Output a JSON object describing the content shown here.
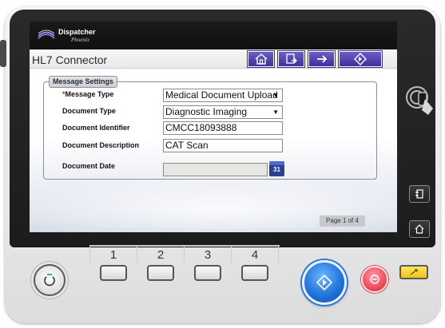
{
  "app": {
    "brand_name": "Dispatcher",
    "brand_sub": "Phoenix"
  },
  "header": {
    "title": "HL7 Connector",
    "buttons": [
      {
        "name": "home",
        "icon": "home-icon"
      },
      {
        "name": "document-transfer",
        "icon": "document-transfer-icon"
      },
      {
        "name": "next",
        "icon": "arrow-right-icon"
      },
      {
        "name": "start",
        "icon": "diamond-start-icon"
      }
    ]
  },
  "form": {
    "legend": "Message Settings",
    "fields": {
      "message_type": {
        "label": "Message Type",
        "required_mark": "*",
        "value": "Medical Document Upload"
      },
      "document_type": {
        "label": "Document Type",
        "value": "Diagnostic Imaging"
      },
      "document_identifier": {
        "label": "Document Identifier",
        "value": "CMCC18093888"
      },
      "document_description": {
        "label": "Document Description",
        "value": "CAT Scan"
      },
      "document_date": {
        "label": "Document Date",
        "value": "",
        "calendar_day": "31"
      }
    }
  },
  "pagination": {
    "text": "Page 1 of 4"
  },
  "side_buttons": [
    {
      "name": "nfc-reader",
      "icon": "nfc-touch-icon"
    },
    {
      "name": "job-list",
      "icon": "job-list-icon"
    },
    {
      "name": "home",
      "icon": "home-icon"
    }
  ],
  "panel": {
    "keys": [
      "1",
      "2",
      "3",
      "4"
    ],
    "power": {
      "icon": "power-icon"
    },
    "start": {
      "icon": "diamond-start-icon",
      "color": "#1e6fd9"
    },
    "stop": {
      "icon": "stop-icon",
      "color": "#e8414f"
    },
    "reset": {
      "icon": "reset-icon",
      "color": "#f1c21a"
    }
  },
  "colors": {
    "accent": "#3f2f9c",
    "required": "#c0202a",
    "calendar": "#2b3f8f"
  }
}
